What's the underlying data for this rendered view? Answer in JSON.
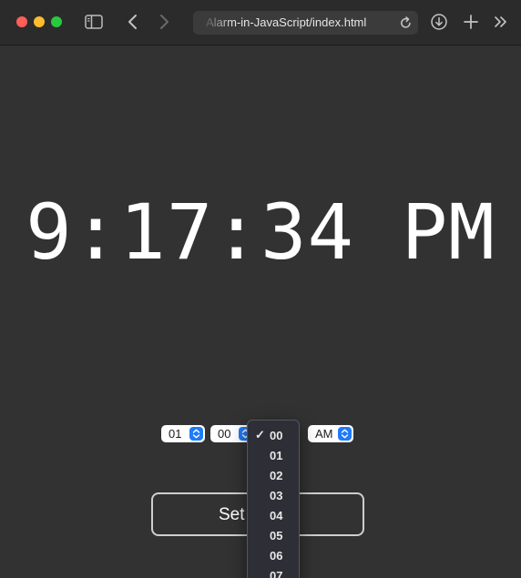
{
  "browser": {
    "url": "Alarm-in-JavaScript/index.html",
    "icons": [
      "sidebar-icon",
      "back-icon",
      "forward-icon",
      "reload-icon",
      "download-icon",
      "new-tab-icon",
      "more-icon"
    ]
  },
  "clock": {
    "time": "9:17:34 PM"
  },
  "alarm": {
    "hour": "01",
    "minute": "00",
    "ampm": "AM",
    "button_label": "Set"
  },
  "minute_dropdown": {
    "selected": "00",
    "options": [
      "00",
      "01",
      "02",
      "03",
      "04",
      "05",
      "06",
      "07"
    ]
  },
  "colors": {
    "page_bg": "#333232",
    "accent": "#1f7bf7",
    "close": "#fe5f57",
    "minimize": "#febc2e",
    "zoom": "#28c840"
  }
}
